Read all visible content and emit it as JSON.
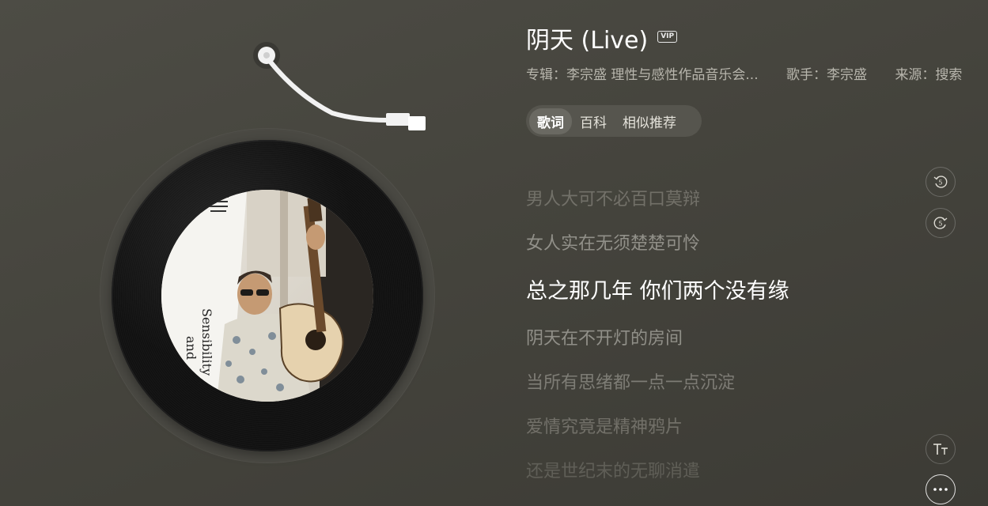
{
  "song": {
    "title": "阴天 (Live)",
    "vip_badge": "VIP"
  },
  "meta": {
    "album": "专辑：李宗盛 理性与感性作品音乐会...",
    "singer": "歌手：李宗盛",
    "source": "来源：搜索"
  },
  "tabs": [
    {
      "label": "歌词",
      "active": true
    },
    {
      "label": "百科",
      "active": false
    },
    {
      "label": "相似推荐",
      "active": false
    }
  ],
  "lyrics": {
    "lines": [
      "男人大可不必百口莫辩",
      "女人实在无须楚楚可怜",
      "总之那几年 你们两个没有缘",
      "阴天在不开灯的房间",
      "当所有思绪都一点一点沉淀",
      "爱情究竟是精神鸦片",
      "还是世纪末的无聊消遣"
    ],
    "current_index": 2
  },
  "controls": {
    "rewind_label": "5",
    "forward_label": "5",
    "font_size_icon": "text-size-icon",
    "more_icon": "more-icon"
  },
  "cover": {
    "text_lines": [
      "Sensibility",
      "and"
    ]
  }
}
